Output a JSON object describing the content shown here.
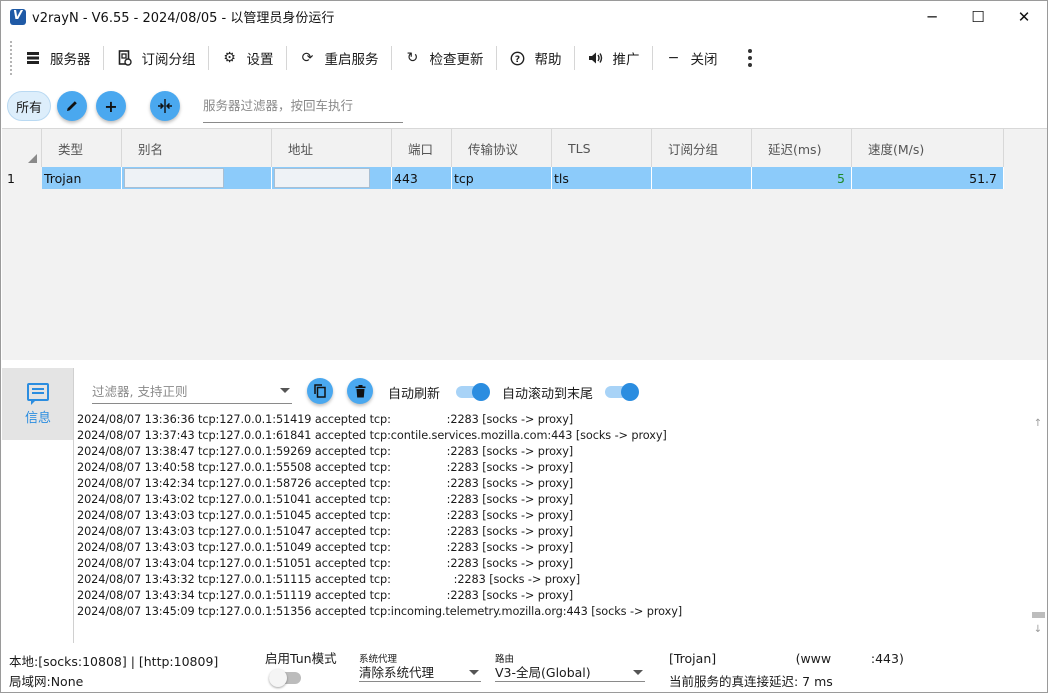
{
  "window": {
    "title": "v2rayN - V6.55 - 2024/08/05 - 以管理员身份运行",
    "controls": {
      "minimize": "─",
      "maximize": "☐",
      "close": "✕"
    }
  },
  "toolbar": {
    "items": [
      {
        "label": "服务器",
        "icon": "server-icon"
      },
      {
        "label": "订阅分组",
        "icon": "subscription-icon"
      },
      {
        "label": "设置",
        "icon": "gear-icon"
      },
      {
        "label": "重启服务",
        "icon": "restart-icon"
      },
      {
        "label": "检查更新",
        "icon": "update-icon"
      },
      {
        "label": "帮助",
        "icon": "help-icon"
      },
      {
        "label": "推广",
        "icon": "speaker-icon"
      },
      {
        "label": "关闭",
        "icon": "minus-icon"
      }
    ]
  },
  "filter": {
    "chip_all": "所有",
    "server_filter_placeholder": "服务器过滤器，按回车执行"
  },
  "grid": {
    "columns": [
      "类型",
      "别名",
      "地址",
      "端口",
      "传输协议",
      "TLS",
      "订阅分组",
      "延迟(ms)",
      "速度(M/s)"
    ],
    "rows": [
      {
        "index": "1",
        "type": "Trojan",
        "alias": "",
        "address": "",
        "port": "443",
        "transport": "tcp",
        "tls": "tls",
        "subscription": "",
        "latency": "5",
        "speed": "51.7"
      }
    ]
  },
  "log": {
    "tab_label": "信息",
    "filter_placeholder": "过滤器, 支持正则",
    "auto_refresh_label": "自动刷新",
    "auto_scroll_label": "自动滚动到末尾",
    "auto_refresh": true,
    "auto_scroll": true,
    "lines": [
      "2024/08/07 13:36:36 tcp:127.0.0.1:51419 accepted tcp:                :2283 [socks -> proxy]",
      "2024/08/07 13:37:43 tcp:127.0.0.1:61841 accepted tcp:contile.services.mozilla.com:443 [socks -> proxy]",
      "2024/08/07 13:38:47 tcp:127.0.0.1:59269 accepted tcp:                :2283 [socks -> proxy]",
      "2024/08/07 13:40:58 tcp:127.0.0.1:55508 accepted tcp:                :2283 [socks -> proxy]",
      "2024/08/07 13:42:34 tcp:127.0.0.1:58726 accepted tcp:                :2283 [socks -> proxy]",
      "2024/08/07 13:43:02 tcp:127.0.0.1:51041 accepted tcp:                :2283 [socks -> proxy]",
      "2024/08/07 13:43:03 tcp:127.0.0.1:51045 accepted tcp:                :2283 [socks -> proxy]",
      "2024/08/07 13:43:03 tcp:127.0.0.1:51047 accepted tcp:                :2283 [socks -> proxy]",
      "2024/08/07 13:43:03 tcp:127.0.0.1:51049 accepted tcp:                :2283 [socks -> proxy]",
      "2024/08/07 13:43:04 tcp:127.0.0.1:51051 accepted tcp:                :2283 [socks -> proxy]",
      "2024/08/07 13:43:32 tcp:127.0.0.1:51115 accepted tcp:                  :2283 [socks -> proxy]",
      "2024/08/07 13:43:34 tcp:127.0.0.1:51119 accepted tcp:                :2283 [socks -> proxy]",
      "2024/08/07 13:45:09 tcp:127.0.0.1:51356 accepted tcp:incoming.telemetry.mozilla.org:443 [socks -> proxy]"
    ]
  },
  "status": {
    "local_ports": "本地:[socks:10808] | [http:10809]",
    "lan": "局域网:None",
    "tun_label": "启用Tun模式",
    "tun_enabled": false,
    "sys_proxy_caption": "系统代理",
    "sys_proxy_value": "清除系统代理",
    "routing_caption": "路由",
    "routing_value": "V3-全局(Global)",
    "server_info": "[Trojan]                    (www          :443)",
    "real_delay": "当前服务的真连接延迟: 7 ms"
  },
  "colors": {
    "accent": "#2b8de0",
    "fab": "#4aa8ef",
    "row_selected": "#8ccbfa",
    "latency_ok": "#1f8a2b"
  }
}
